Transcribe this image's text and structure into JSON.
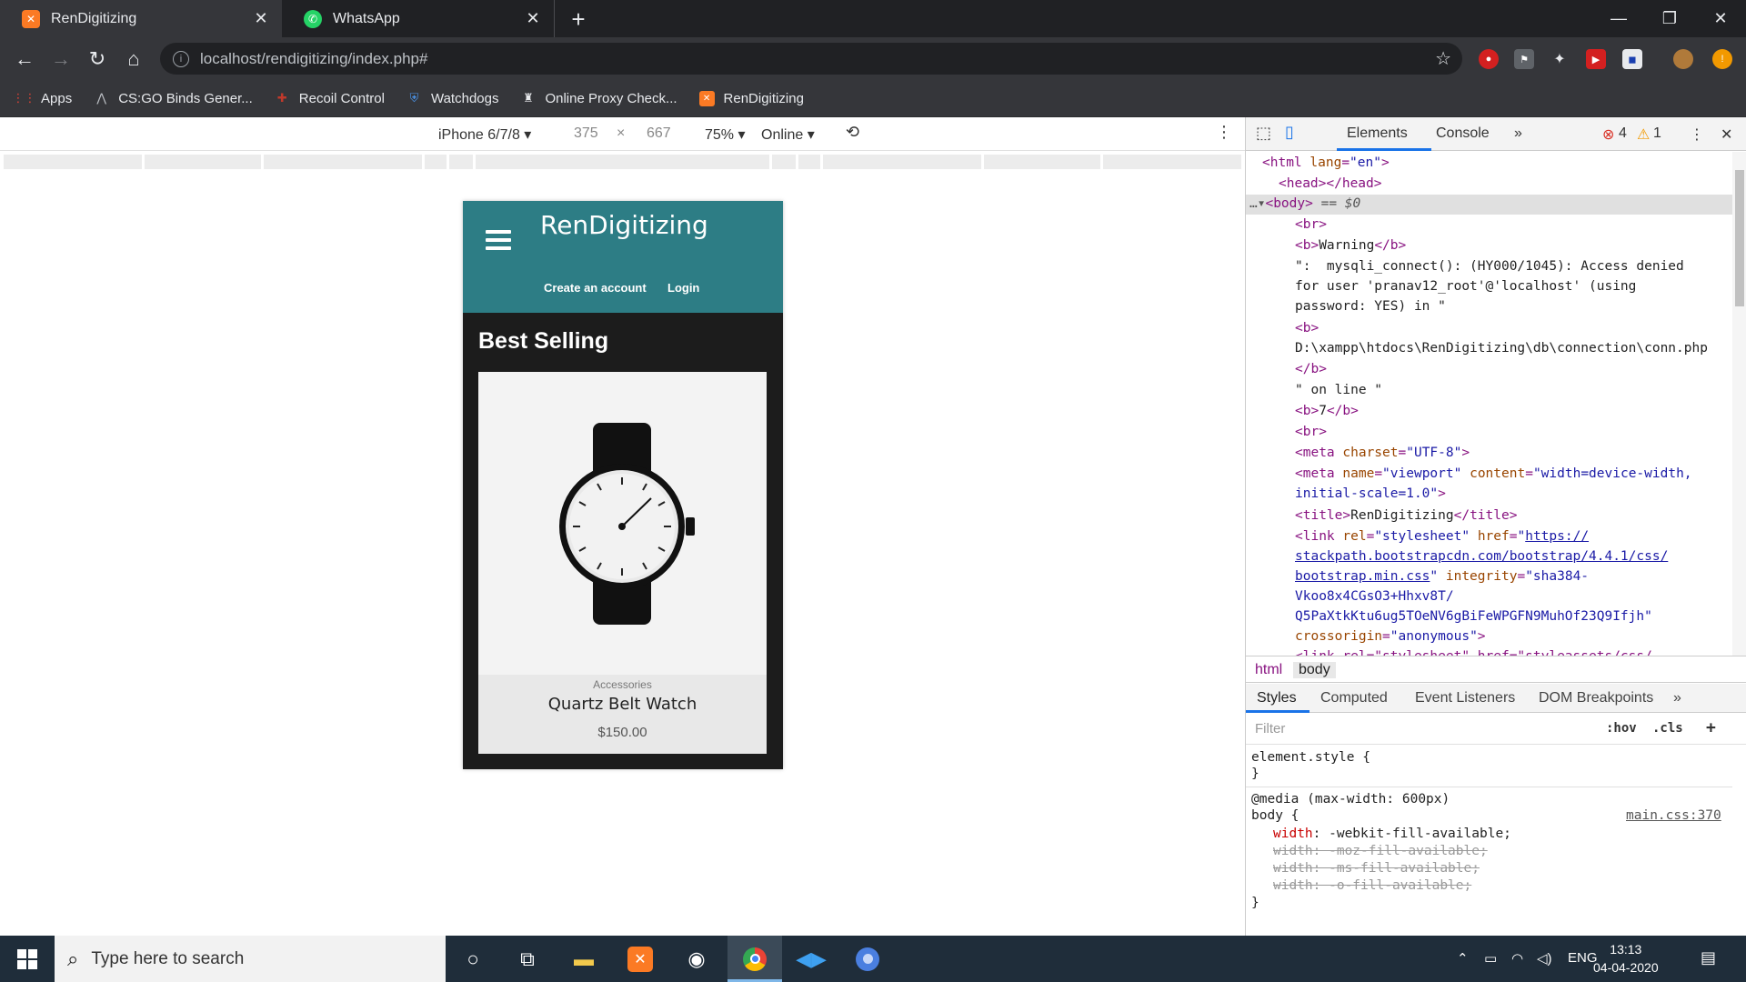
{
  "browser": {
    "tabs": [
      {
        "title": "RenDigitizing",
        "icon": "xampp-icon",
        "active": true
      },
      {
        "title": "WhatsApp",
        "icon": "whatsapp-icon",
        "active": false
      }
    ],
    "url": "localhost/rendigitizing/index.php#",
    "bookmarks": [
      {
        "label": "Apps",
        "icon": "apps-grid-icon"
      },
      {
        "label": "CS:GO Binds Gener...",
        "icon": "csgo-icon"
      },
      {
        "label": "Recoil Control",
        "icon": "recoil-icon"
      },
      {
        "label": "Watchdogs",
        "icon": "shield-icon"
      },
      {
        "label": "Online Proxy Check...",
        "icon": "proxy-icon"
      },
      {
        "label": "RenDigitizing",
        "icon": "xampp-icon"
      }
    ]
  },
  "device_toolbar": {
    "device": "iPhone 6/7/8",
    "width": "375",
    "times": "×",
    "height": "667",
    "zoom": "75%",
    "network": "Online"
  },
  "site": {
    "brand": "RenDigitizing",
    "nav_links": [
      "Create an account",
      "Login"
    ],
    "section_title": "Best Selling",
    "product": {
      "category": "Accessories",
      "name": "Quartz Belt Watch",
      "price": "$150.00"
    }
  },
  "devtools": {
    "tabs": [
      "Elements",
      "Console"
    ],
    "error_count": "4",
    "warning_count": "1",
    "selected_suffix": "== $0",
    "breadcrumbs": [
      "html",
      "body"
    ],
    "sub_tabs": [
      "Styles",
      "Computed",
      "Event Listeners",
      "DOM Breakpoints"
    ],
    "filter_placeholder": "Filter",
    "hov": ":hov",
    "cls": ".cls",
    "dom_lines": {
      "l1_open": "<html ",
      "l1_attr": "lang",
      "l1_val": "\"en\"",
      "l1_close": ">",
      "l2": "<head></head>",
      "l3": "<body>",
      "l4": "<br>",
      "l5_tag_open": "<b>",
      "l5_text": "Warning",
      "l5_tag_close": "</b>",
      "l6": "\":  mysqli_connect(): (HY000/1045): Access denied",
      "l7": "for user 'pranav12_root'@'localhost' (using",
      "l8": "password: YES) in \"",
      "l9": "<b>",
      "l10": "D:\\xampp\\htdocs\\RenDigitizing\\db\\connection\\conn.php",
      "l11": "</b>",
      "l12": "\" on line \"",
      "l13_open": "<b>",
      "l13_text": "7",
      "l13_close": "</b>",
      "l14": "<br>",
      "l15_tag": "<meta ",
      "l15_attr": "charset",
      "l15_val": "\"UTF-8\"",
      "l15_end": ">",
      "l16_tag": "<meta ",
      "l16_a1": "name",
      "l16_v1": "\"viewport\"",
      "l16_a2": " content",
      "l16_v2": "\"width=device-width,",
      "l17_v": "initial-scale=1.0\"",
      "l17_end": ">",
      "l18_open": "<title>",
      "l18_text": "RenDigitizing",
      "l18_close": "</title>",
      "l19_tag": "<link ",
      "l19_a1": "rel",
      "l19_v1": "\"stylesheet\"",
      "l19_a2": " href",
      "l19_q": "\"",
      "l19_link": "https://",
      "l20_link": "stackpath.bootstrapcdn.com/bootstrap/4.4.1/css/",
      "l21_link": "bootstrap.min.css",
      "l21_q": "\"",
      "l21_a": " integrity",
      "l21_v": "\"sha384-",
      "l22": "Vkoo8x4CGsO3+Hhxv8T/",
      "l23": "Q5PaXtkKtu6ug5TOeNV6gBiFeWPGFN9MuhOf23Q9Ifjh\"",
      "l24_a": "crossorigin",
      "l24_v": "\"anonymous\"",
      "l24_end": ">",
      "l25": "<link rel=\"stylesheet\" href=\"styleassets/css/"
    },
    "styles": {
      "element_style": "element.style {",
      "close_brace": "}",
      "media": "@media (max-width: 600px)",
      "selector": "body {",
      "source": "main.css:370",
      "prop1_name": "width",
      "prop1_val": ": -webkit-fill-available;",
      "prop2": "width: -moz-fill-available;",
      "prop3": "width: -ms-fill-available;",
      "prop4": "width: -o-fill-available;"
    }
  },
  "taskbar": {
    "search_placeholder": "Type here to search",
    "language": "ENG",
    "time": "13:13",
    "date": "04-04-2020"
  }
}
